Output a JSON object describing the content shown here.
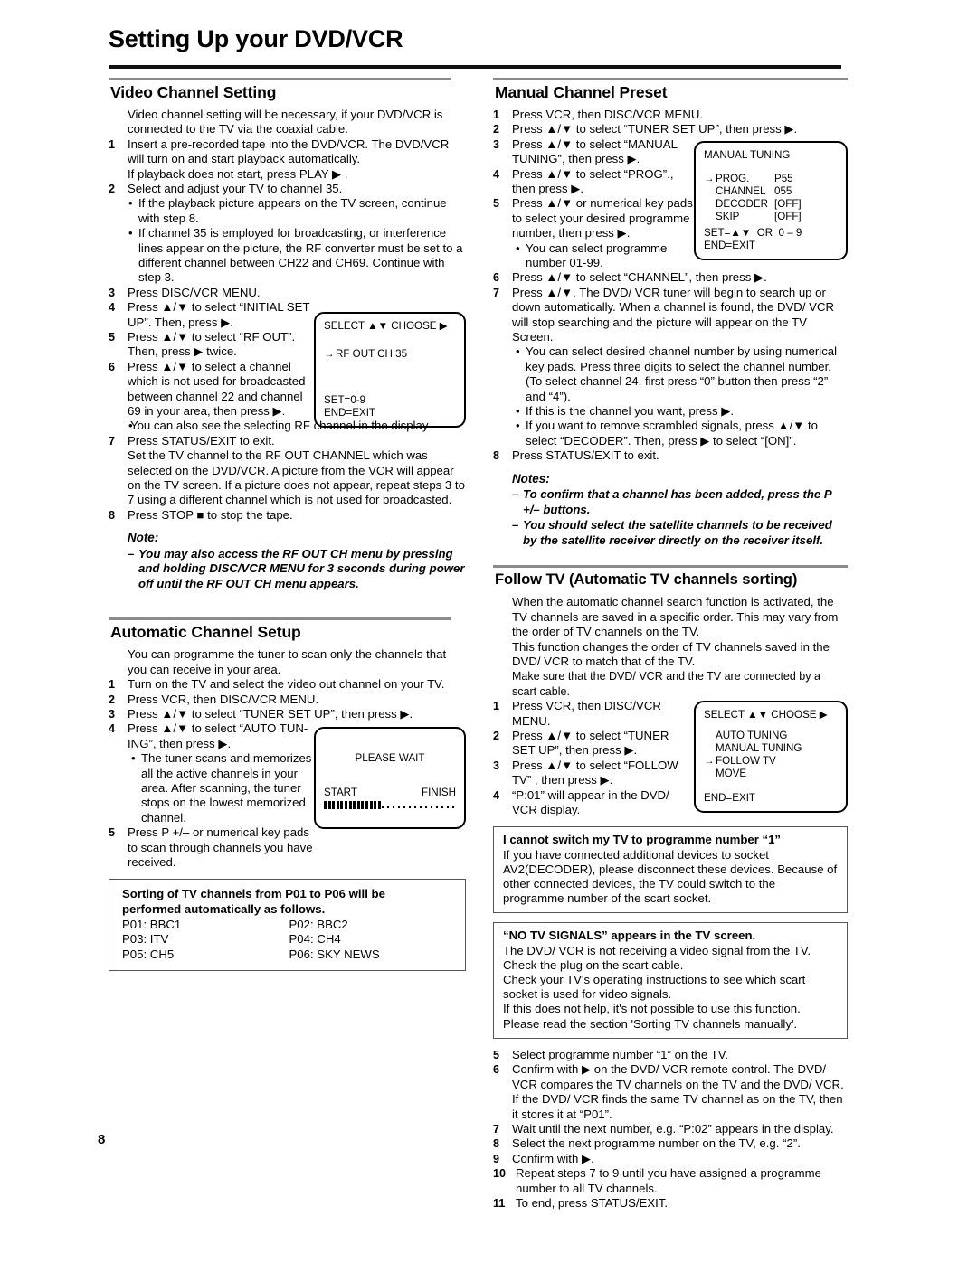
{
  "header": {
    "title": "Setting Up your DVD/VCR"
  },
  "page_number": "8",
  "left": {
    "video_channel": {
      "title": "Video Channel Setting",
      "intro": "Video channel setting will be necessary, if your DVD/VCR is connected to the TV via the coaxial cable.",
      "s1a": "Insert a pre-recorded tape into the DVD/VCR. The DVD/VCR will turn on and start playback automatically.",
      "s1b": "If playback does not start, press PLAY ▶ .",
      "s2": "Select and adjust your TV to channel 35.",
      "s2b1": "If the playback picture appears on the TV screen, continue with step 8.",
      "s2b2": "If channel 35 is employed for broadcasting, or interference lines appear on the picture, the RF converter must be set to a different channel between CH22 and CH69. Continue with step 3.",
      "s3": "Press DISC/VCR MENU.",
      "s4": "Press ▲/▼ to select “INITIAL SET UP”. Then, press ▶.",
      "s5": "Press ▲/▼ to select “RF OUT”. Then,  press ▶ twice.",
      "s6": "Press ▲/▼ to select a channel which is not used for broadcasted between channel 22 and channel 69 in your area, then press ▶.",
      "s6b": "You can also see the selecting RF channel in the display",
      "s7a": "Press STATUS/EXIT to exit.",
      "s7b": "Set the TV channel to the RF OUT CHANNEL which was selected on the DVD/VCR. A picture from the VCR will appear on the TV screen. If a picture does not appear, repeat steps 3 to 7 using a different channel which is not used for broadcasted.",
      "s8": "Press STOP ■ to stop the tape.",
      "note_title": "Note:",
      "note_1": "You may also access the RF OUT CH menu by pressing and holding DISC/VCR MENU for 3 seconds during power off until the RF OUT CH menu appears.",
      "osd": {
        "top": "SELECT ▲▼  CHOOSE ▶",
        "item": "RF OUT CH 35",
        "arrow": "→",
        "bot1": "SET=0-9",
        "bot2": "END=EXIT"
      }
    },
    "auto_setup": {
      "title": "Automatic Channel Setup",
      "intro": "You can programme the tuner to scan only the channels that you can receive in your area.",
      "s1": "Turn on the TV and select the video out channel on your TV.",
      "s2": "Press VCR, then DISC/VCR MENU.",
      "s3": "Press ▲/▼ to select “TUNER SET UP”, then press ▶.",
      "s4": "Press ▲/▼ to select “AUTO TUN-ING”, then press ▶.",
      "s4b": "The tuner scans and memorizes all the active channels in your area. After scanning, the tuner stops on the lowest memorized channel.",
      "s5": "Press P +/– or numerical key pads to scan through channels you have received.",
      "osd": {
        "wait": "PLEASE WAIT",
        "start": "START",
        "finish": "FINISH",
        "filled_blocks": 14,
        "empty_dots": 14
      },
      "sorting_box": {
        "title_line1": "Sorting of TV channels from P01 to P06 will be",
        "title_line2": "performed automatically as follows.",
        "rows": [
          {
            "left": "P01:  BBC1",
            "right": "P02:  BBC2"
          },
          {
            "left": "P03:  ITV",
            "right": "P04:  CH4"
          },
          {
            "left": "P05:  CH5",
            "right": "P06:  SKY NEWS"
          }
        ]
      }
    }
  },
  "right": {
    "manual_preset": {
      "title": "Manual Channel Preset",
      "s1": "Press VCR, then DISC/VCR MENU.",
      "s2": "Press ▲/▼ to select “TUNER SET UP”, then press ▶.",
      "s3": "Press ▲/▼ to select “MANUAL TUNING”, then press ▶.",
      "s4": "Press ▲/▼ to select “PROG”., then press ▶.",
      "s5": "Press ▲/▼ or numerical key pads to select your desired programme number, then press ▶.",
      "s5b": "You can select programme number 01-99.",
      "s6": "Press ▲/▼ to select “CHANNEL”, then press ▶.",
      "s7": "Press ▲/▼. The DVD/ VCR tuner will begin to search up or down automatically. When a channel is found, the DVD/ VCR will stop searching and the picture will appear on the TV Screen.",
      "s7b1": "You can select desired channel number by using numerical key pads. Press three digits to select the channel number. (To select channel 24, first press “0” button then press “2” and “4”).",
      "s7b2": "If this is the channel you want, press ▶.",
      "s7b3": "If you want to remove scrambled signals, press ▲/▼ to select “DECODER”. Then, press ▶ to select “[ON]”.",
      "s8": "Press STATUS/EXIT to exit.",
      "notes_title": "Notes:",
      "note_1": "To confirm that a channel has been added, press the P +/– buttons.",
      "note_2": "You should select the satellite channels to be received by the satellite receiver directly on the receiver itself.",
      "osd": {
        "title": "MANUAL TUNING",
        "arrow": "→",
        "rows": [
          {
            "key": "PROG.",
            "val": "P55",
            "selected": true
          },
          {
            "key": "CHANNEL",
            "val": "055",
            "selected": false
          },
          {
            "key": "DECODER",
            "val": "[OFF]",
            "selected": false
          },
          {
            "key": "SKIP",
            "val": "[OFF]",
            "selected": false
          }
        ],
        "bot1": "SET=▲▼  OR  0 – 9",
        "bot2": "END=EXIT"
      }
    },
    "follow_tv": {
      "title": "Follow TV (Automatic TV channels sorting)",
      "p1": "When the automatic channel search function is activated, the TV channels are saved in a specific order. This may vary from the order of TV channels on the TV.",
      "p2": "This function changes the order of TV channels saved in the DVD/ VCR to match that of the TV.",
      "p3": "Make sure that the DVD/ VCR and the TV are connected by a scart cable.",
      "s1": "Press VCR, then DISC/VCR MENU.",
      "s2": "Press ▲/▼ to select “TUNER SET UP”, then press ▶.",
      "s3": "Press ▲/▼ to select “FOLLOW TV” , then press ▶.",
      "s4": "“P:01” will appear in the DVD/ VCR display.",
      "s5": "Select programme number “1” on the TV.",
      "s6": "Confirm with ▶ on the DVD/ VCR remote control. The DVD/ VCR compares the TV channels on the TV and the DVD/ VCR. If the DVD/ VCR finds the same TV channel as on the TV, then it stores it at “P01”.",
      "s7": "Wait until the next number, e.g. “P:02” appears in the display.",
      "s8": "Select the next programme number on the TV, e.g. “2”.",
      "s9": "Confirm with ▶.",
      "s10": "Repeat steps 7 to 9 until you have assigned a programme number to all TV channels.",
      "s11": "To end, press STATUS/EXIT.",
      "osd": {
        "top": "SELECT ▲▼  CHOOSE ▶",
        "arrow": "→",
        "items": [
          "AUTO TUNING",
          "MANUAL TUNING",
          "FOLLOW TV",
          "MOVE"
        ],
        "selected_index": 2,
        "bot": "END=EXIT"
      },
      "faq1": {
        "title": "I cannot switch my TV to programme number “1”",
        "body": "If you have connected additional devices to socket AV2(DECODER), please disconnect these devices. Because of other connected devices, the TV could switch to the programme number of the scart socket."
      },
      "faq2": {
        "title": "“NO TV SIGNALS” appears in the TV screen.",
        "l1": "The DVD/ VCR is not receiving a video signal from the TV.",
        "l2": "Check the plug on the scart cable.",
        "l3": "Check your TV's operating instructions to see which scart socket is used for video signals.",
        "l4": "If this does not help, it's not possible to use this function. Please read the section 'Sorting TV channels manually'."
      }
    }
  }
}
